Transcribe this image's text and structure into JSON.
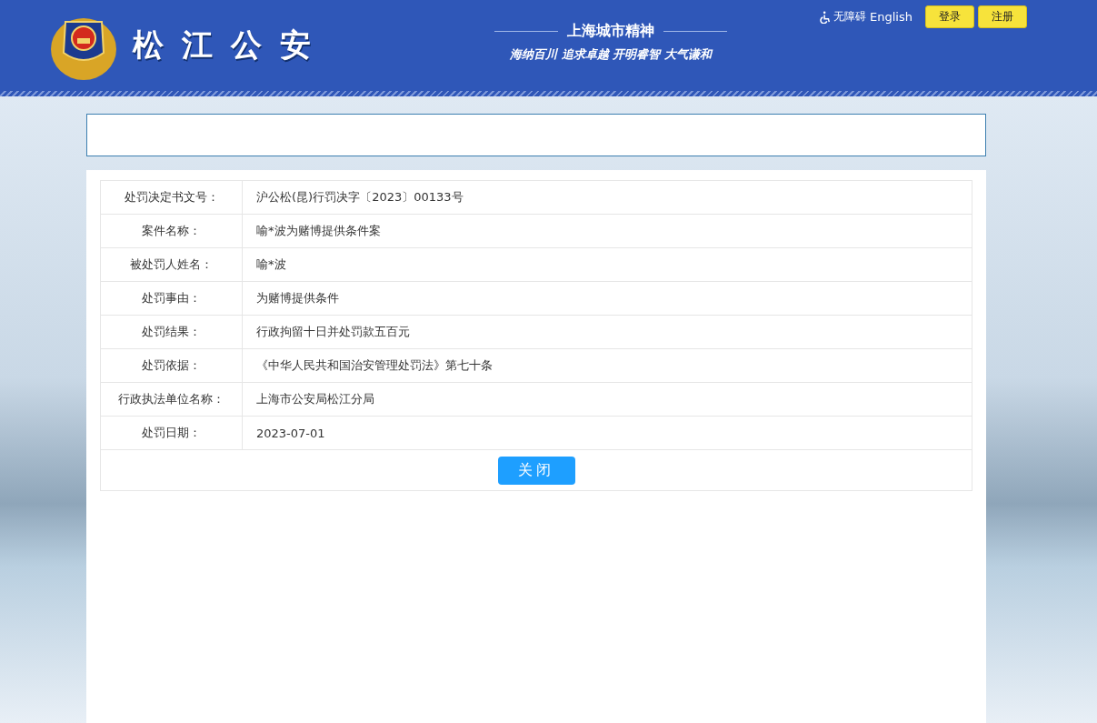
{
  "header": {
    "site_title": "松江公安",
    "slogan_title": "上海城市精神",
    "slogan": "海纳百川 追求卓越 开明睿智 大气谦和",
    "accessibility": "无障碍",
    "language": "English",
    "buttons": [
      "登录",
      "注册"
    ]
  },
  "details": [
    {
      "label": "处罚决定书文号：",
      "value": "沪公松(昆)行罚决字〔2023〕00133号"
    },
    {
      "label": "案件名称：",
      "value": "喻*波为赌博提供条件案"
    },
    {
      "label": "被处罚人姓名：",
      "value": "喻*波"
    },
    {
      "label": "处罚事由：",
      "value": "为赌博提供条件"
    },
    {
      "label": "处罚结果：",
      "value": "行政拘留十日并处罚款五百元"
    },
    {
      "label": "处罚依据：",
      "value": "《中华人民共和国治安管理处罚法》第七十条"
    },
    {
      "label": "行政执法单位名称：",
      "value": "上海市公安局松江分局"
    },
    {
      "label": "处罚日期：",
      "value": "2023-07-01"
    }
  ],
  "close_button": "关闭"
}
